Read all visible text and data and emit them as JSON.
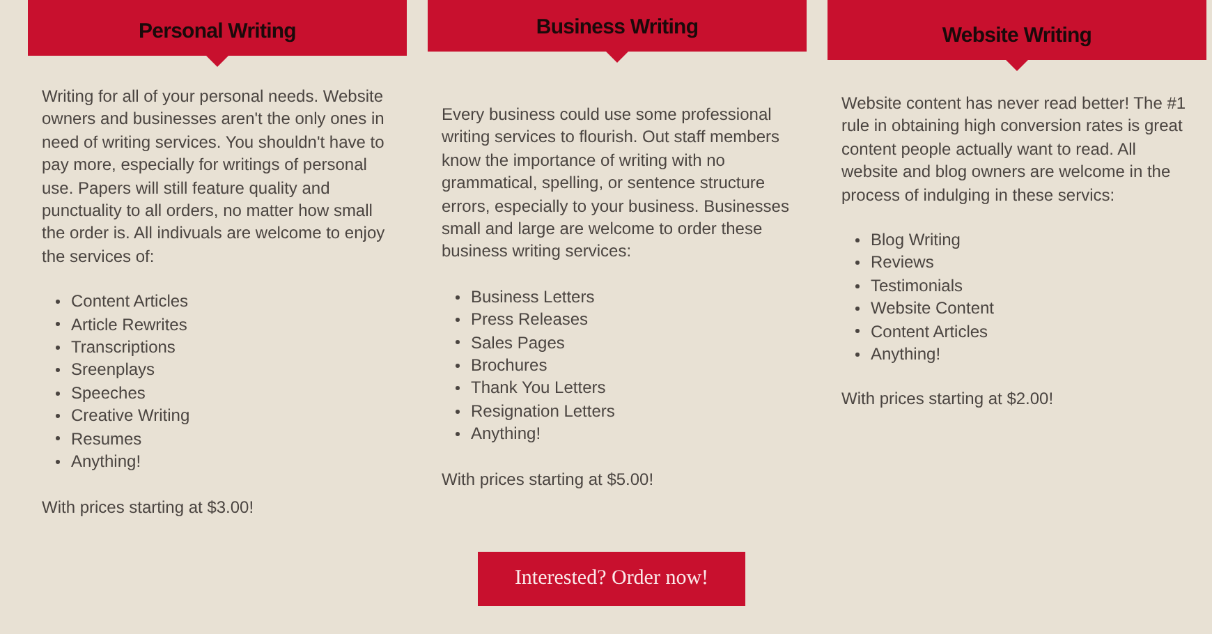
{
  "columns": [
    {
      "title": "Personal Writing",
      "description": "Writing for all of your personal needs. Website owners and businesses aren't the only ones in need of writing services. You shouldn't have to pay more, especially for writings of personal use. Papers will still feature quality and punctuality to all orders, no matter how small the order is. All indivuals are welcome to enjoy the services of:",
      "services": [
        "Content Articles",
        "Article Rewrites",
        "Transcriptions",
        "Sreenplays",
        "Speeches",
        "Creative Writing",
        "Resumes",
        "Anything!"
      ],
      "price_note": "With prices starting at $3.00!"
    },
    {
      "title": "Business Writing",
      "description": "Every business could use some professional writing services to flourish. Out staff members know the importance of writing with no grammatical, spelling, or sentence structure errors, especially to your business. Businesses small and large are welcome to order these business writing services:",
      "services": [
        "Business Letters",
        "Press Releases",
        "Sales Pages",
        "Brochures",
        "Thank You Letters",
        "Resignation Letters",
        "Anything!"
      ],
      "price_note": "With prices starting at $5.00!"
    },
    {
      "title": "Website Writing",
      "description": "Website content has never read better! The #1 rule in obtaining high conversion rates is great content people actually want to read. All website and blog owners are welcome in the process of indulging in these servics:",
      "services": [
        "Blog Writing",
        "Reviews",
        "Testimonials",
        "Website Content",
        "Content Articles",
        "Anything!"
      ],
      "price_note": "With prices starting at $2.00!"
    }
  ],
  "order_button": "Interested? Order now!"
}
